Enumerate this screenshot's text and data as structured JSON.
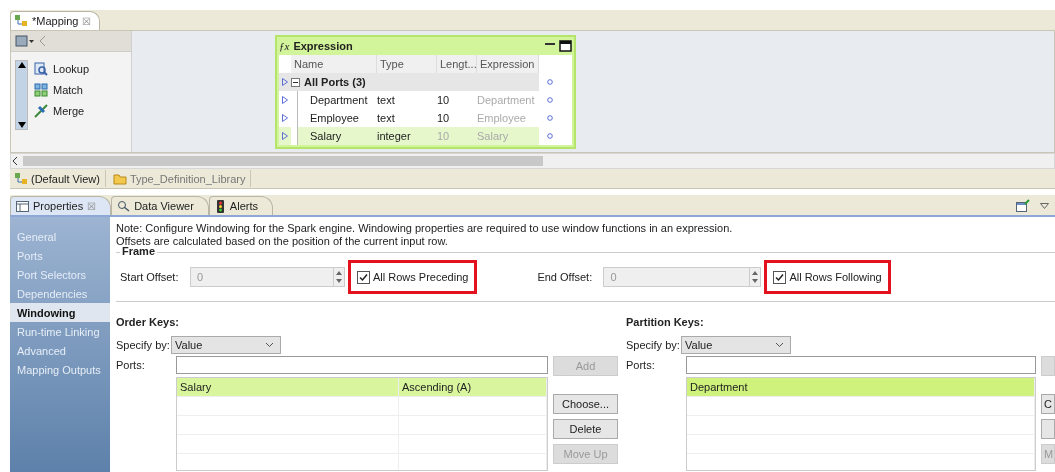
{
  "editor_tab": {
    "title": "*Mapping",
    "close": "☒",
    "selected": true
  },
  "palette": {
    "items": [
      {
        "label": "Lookup"
      },
      {
        "label": "Match"
      },
      {
        "label": "Merge"
      }
    ]
  },
  "expression_node": {
    "icon_text": "ƒx",
    "title": "Expression",
    "columns": [
      "Name",
      "Type",
      "Lengt...",
      "Expression"
    ],
    "group": {
      "label": "All Ports (3)",
      "expanded": true,
      "children": [
        {
          "name": "Department",
          "type": "text",
          "length": "10",
          "expression": "Department",
          "selected": false
        },
        {
          "name": "Employee",
          "type": "text",
          "length": "10",
          "expression": "Employee",
          "selected": false
        },
        {
          "name": "Salary",
          "type": "integer",
          "length": "10",
          "expression": "Salary",
          "selected": true
        }
      ]
    }
  },
  "view_tabs": [
    {
      "label": "(Default View)",
      "selected": true
    },
    {
      "label": "Type_Definition_Library",
      "selected": false
    }
  ],
  "panel_tabs": [
    {
      "label": "Properties",
      "close": "☒",
      "selected": true
    },
    {
      "label": "Data Viewer",
      "selected": false
    },
    {
      "label": "Alerts",
      "selected": false
    }
  ],
  "sidebar": {
    "items": [
      {
        "label": "General",
        "selected": false
      },
      {
        "label": "Ports",
        "selected": false
      },
      {
        "label": "Port Selectors",
        "selected": false
      },
      {
        "label": "Dependencies",
        "selected": false
      },
      {
        "label": "Windowing",
        "selected": true
      },
      {
        "label": "Run-time Linking",
        "selected": false
      },
      {
        "label": "Advanced",
        "selected": false
      },
      {
        "label": "Mapping Outputs",
        "selected": false
      }
    ]
  },
  "note": "Note: Configure Windowing for the Spark engine. Windowing properties are required to use window functions in an expression.\nOffsets are calculated based on the position of the current input row.",
  "frame": {
    "title": "Frame",
    "offsets": [
      {
        "label": "Start Offset:",
        "value": "0",
        "option": "All Rows Preceding",
        "checked": true,
        "highlighted": true
      },
      {
        "label": "End Offset:",
        "value": "0",
        "option": "All Rows Following",
        "checked": true,
        "highlighted": true
      }
    ]
  },
  "order_keys": {
    "title": "Order Keys:",
    "specify_label": "Specify by:",
    "specify_value": "Value",
    "ports_label": "Ports:",
    "rows": [
      {
        "port": "Salary",
        "order": "Ascending (A)",
        "selected": true
      }
    ],
    "buttons": [
      {
        "label": "Add",
        "disabled": true
      },
      {
        "label": "Choose...",
        "disabled": false
      },
      {
        "label": "Delete",
        "disabled": false
      },
      {
        "label": "Move Up",
        "disabled": true
      }
    ]
  },
  "partition_keys": {
    "title": "Partition Keys:",
    "specify_label": "Specify by:",
    "specify_value": "Value",
    "ports_label": "Ports:",
    "rows": [
      {
        "port": "Department",
        "selected": true
      }
    ],
    "buttons": [
      {
        "disabled": true
      },
      {
        "label": "C",
        "disabled": false
      },
      {
        "disabled": false
      },
      {
        "label": "M",
        "disabled": true
      }
    ]
  }
}
